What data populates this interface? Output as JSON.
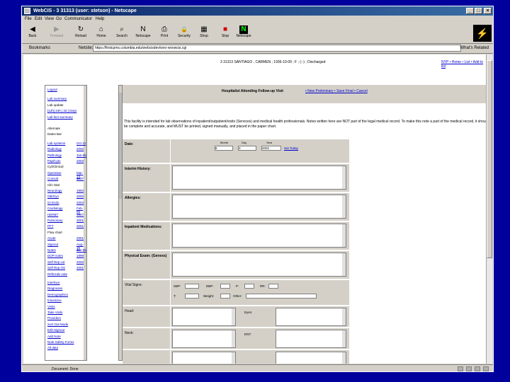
{
  "window": {
    "title": "WebCIS - 3 31313 (user: stetson) - Netscape",
    "minimize_glyph": "_",
    "maximize_glyph": "□",
    "close_glyph": "×"
  },
  "menu": [
    "File",
    "Edit",
    "View",
    "Go",
    "Communicator",
    "Help"
  ],
  "toolbar": [
    {
      "label": "Back",
      "icon": "back-icon",
      "glyph": "◀"
    },
    {
      "label": "Forward",
      "icon": "forward-icon",
      "glyph": "▶"
    },
    {
      "label": "Reload",
      "icon": "reload-icon",
      "glyph": "↻"
    },
    {
      "label": "Home",
      "icon": "home-icon",
      "glyph": "⌂"
    },
    {
      "label": "Search",
      "icon": "search-icon",
      "glyph": "⌕"
    },
    {
      "label": "Netscape",
      "icon": "netscape-icon",
      "glyph": "N"
    },
    {
      "label": "Print",
      "icon": "print-icon",
      "glyph": "⎙"
    },
    {
      "label": "Security",
      "icon": "lock-icon",
      "glyph": "🔒"
    },
    {
      "label": "Shop",
      "icon": "shop-icon",
      "glyph": "▦"
    },
    {
      "label": "Stop",
      "icon": "stop-icon",
      "glyph": "■"
    },
    {
      "label": "Netscape",
      "icon": "netscape-n-icon",
      "glyph": "N"
    }
  ],
  "location": {
    "bookmarks_label": "Bookmarks",
    "netsite_label": "Netsite:",
    "url": "https://firstcpms.columbia.edu/webcisdev/wvo-wvowcis.cgi",
    "whats_related": "What's Related"
  },
  "patient_header": "3 31313 SANTIAGO , CARMEN ; 1936-10-09 ; F ; (--) ; Discharged",
  "top_links": "NYP • Home • List • Add to list",
  "sidebar": [
    {
      "text": "Logout",
      "link": true
    },
    {
      "text": "Lab summary",
      "link": true
    },
    {
      "text": "Lab update",
      "link": false
    },
    {
      "text": "[12h] 24h | 3d | Days",
      "link": true
    },
    {
      "text": "Lab fact summary",
      "link": true
    },
    {
      "text": "Alternate",
      "link": false
    },
    {
      "text": "Dates Bar",
      "link": false
    },
    {
      "text": "Lab systems",
      "link": true,
      "value": "Oct 12"
    },
    {
      "text": "Radiology",
      "link": true,
      "value": "2002"
    },
    {
      "text": "Pathology",
      "link": true,
      "value": "Jan-06"
    },
    {
      "text": "Pap/Cyto",
      "link": true,
      "value": "2003"
    },
    {
      "text": "Cyt/Clinical",
      "link": false
    },
    {
      "text": "Operative",
      "link": true,
      "value": "Mar-13"
    },
    {
      "text": "Consult",
      "link": true,
      "value": "1997"
    },
    {
      "text": "Clin Stat",
      "link": false
    },
    {
      "text": "Neurology",
      "link": true,
      "value": "1993"
    },
    {
      "text": "OB/Gyn",
      "link": true,
      "value": "2000"
    },
    {
      "text": "GI Endo",
      "link": true,
      "value": "2003"
    },
    {
      "text": "Cardiology",
      "link": true,
      "value": "Feb-06"
    },
    {
      "text": "HERBT",
      "link": true,
      "value": "1997"
    },
    {
      "text": "Pulmonary",
      "link": true,
      "value": "2001"
    },
    {
      "text": "PFT",
      "link": true,
      "value": "2001"
    },
    {
      "text": "Flow chart",
      "link": false
    },
    {
      "text": "Acute",
      "link": true,
      "value": "2001"
    },
    {
      "text": "Signout",
      "link": true,
      "value": "Aug-15"
    },
    {
      "text": "Notes",
      "link": true,
      "value": "Jan-05"
    },
    {
      "text": "DOP notes",
      "link": true,
      "value": "1999"
    },
    {
      "text": "Self Rep Lst",
      "link": true,
      "value": "2002"
    },
    {
      "text": "Self Rep OS",
      "link": true,
      "value": "2001"
    },
    {
      "text": "Referrals vote",
      "link": true
    },
    {
      "text": "Interface",
      "link": true
    },
    {
      "text": "Diagnoses",
      "link": true
    },
    {
      "text": "Demographics",
      "link": true
    },
    {
      "text": "Insurance",
      "link": true
    },
    {
      "text": "Visits",
      "link": true
    },
    {
      "text": "Take Visits",
      "link": true
    },
    {
      "text": "Providers",
      "link": true
    },
    {
      "text": "Sort Out Mode",
      "link": true
    },
    {
      "text": "Edit Signout",
      "link": true
    },
    {
      "text": "Add Note",
      "link": true
    },
    {
      "text": "Note Safety Forms",
      "link": true
    },
    {
      "text": "All data",
      "link": true
    }
  ],
  "form_header": {
    "title": "Hospitalist Attending Follow-up Visit",
    "links": "• New Preliminary • Save Final • Cancel"
  },
  "notice": "This facility is intended for lab observations of inpatient/outpatient/visits (Services) and medical health professionals. Notes written here are NOT part of the legal medical record. To make this note a part of the medical record, it should be complete and accurate, and MUST be printed, signed manually, and placed in the paper chart.",
  "form": {
    "date_label": "Date:",
    "date_col_labels": [
      "Month",
      "Day",
      "Year"
    ],
    "date_values": [
      "8",
      "3",
      "2002"
    ],
    "set_today": "Set Today",
    "interim_label": "Interim History:",
    "allergies_label": "Allergies:",
    "meds_label": "Inpatient Medications:",
    "exam_label": "Physical Exam: (Genexs)",
    "vitals_label": "Vital Signs:",
    "vitals": {
      "sbp": "SBP:",
      "dbp": "DBP:",
      "p": "P:",
      "rr": "RR:",
      "t": "T:",
      "weight": "Weight:",
      "other": "Other:"
    },
    "head_label": "Head:",
    "eyes_label": "Eyes:",
    "neck_label": "Neck:",
    "ent_label": "ENT:"
  },
  "status": "Document: Done"
}
